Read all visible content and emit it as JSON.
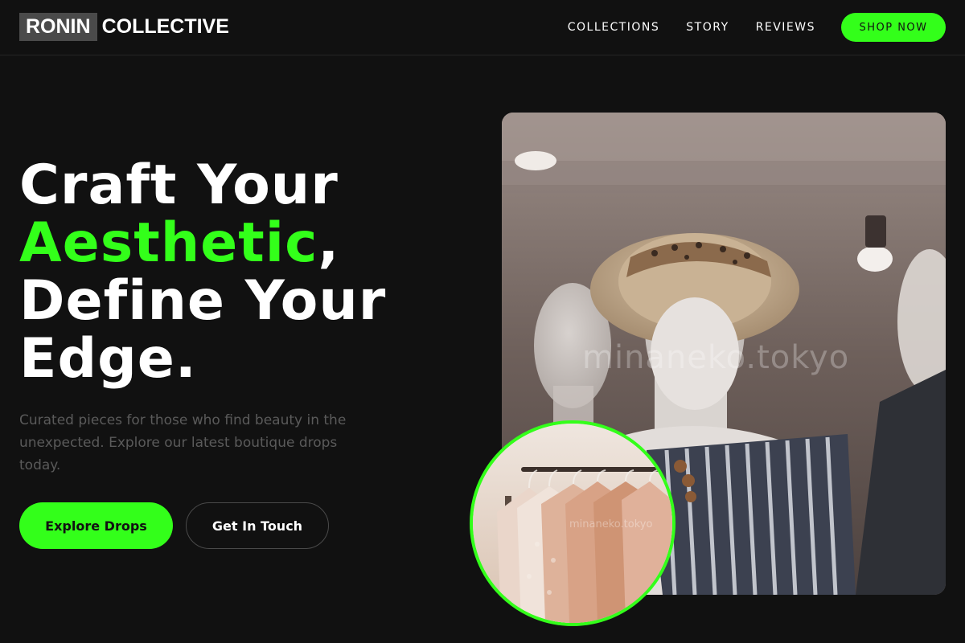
{
  "brand": {
    "logo_box": "RONIN",
    "logo_rest": "COLLECTIVE"
  },
  "nav": {
    "links": [
      "COLLECTIONS",
      "STORY",
      "REVIEWS"
    ],
    "cta": "SHOP NOW"
  },
  "hero": {
    "title_line1": "Craft Your",
    "title_accent": "Aesthetic",
    "title_comma": ",",
    "title_line3": "Define Your",
    "title_line4": "Edge.",
    "description": "Curated pieces for those who find beauty in the unexpected. Explore our latest boutique drops today.",
    "primary_button": "Explore Drops",
    "secondary_button": "Get In Touch"
  },
  "images": {
    "main_watermark": "minaneko.tokyo",
    "circle_watermark": "minaneko.tokyo"
  },
  "colors": {
    "accent": "#33ff1a",
    "background": "#111111",
    "muted_text": "#5a5a5a"
  },
  "icons": {
    "main_image": "mannequin-hat-photo",
    "circle_image": "clothing-rack-photo"
  }
}
